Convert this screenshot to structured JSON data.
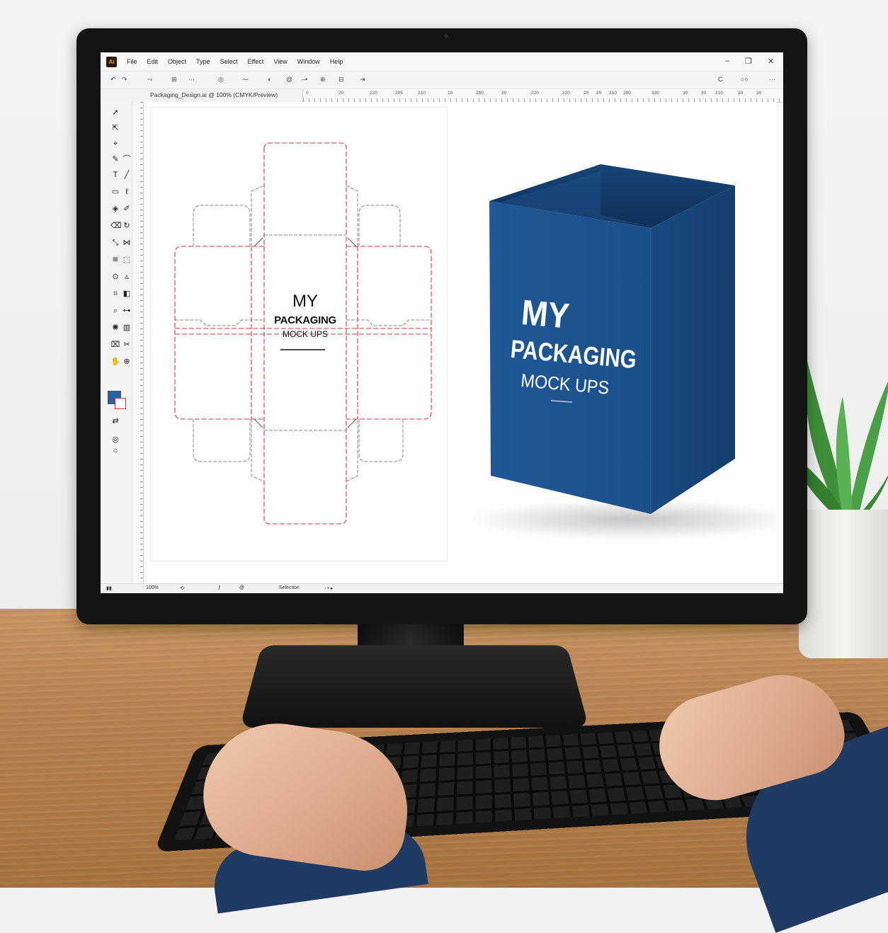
{
  "app": {
    "logo_text": "Ai",
    "menu": [
      "File",
      "Edit",
      "Object",
      "Type",
      "Select",
      "Effect",
      "View",
      "Window",
      "Help"
    ],
    "window_controls": [
      "–",
      "❐",
      "✕"
    ]
  },
  "document": {
    "tab_title": "Packaging_Design.ai @ 100% (CMYK/Preview)"
  },
  "ruler": {
    "ticks": [
      "0",
      "20",
      "220",
      "205",
      "210",
      "10",
      "280",
      "20",
      "220",
      "220",
      "20",
      "20",
      "210",
      "280",
      "330",
      "30",
      "30",
      "210",
      "30",
      "30"
    ]
  },
  "artwork": {
    "dieline_text": {
      "line1": "MY",
      "line2": "PACKAGING",
      "line3": "MOCK UPS"
    },
    "mockup_text": {
      "line1": "MY",
      "line2": "PACKAGING",
      "line3": "MOCK UPS"
    },
    "colors": {
      "box_blue": "#1e5592",
      "dieline_red": "#d9363e",
      "fill_swatch": "#2463a6"
    }
  },
  "status": {
    "zoom": "100%",
    "mode": "Selection"
  }
}
